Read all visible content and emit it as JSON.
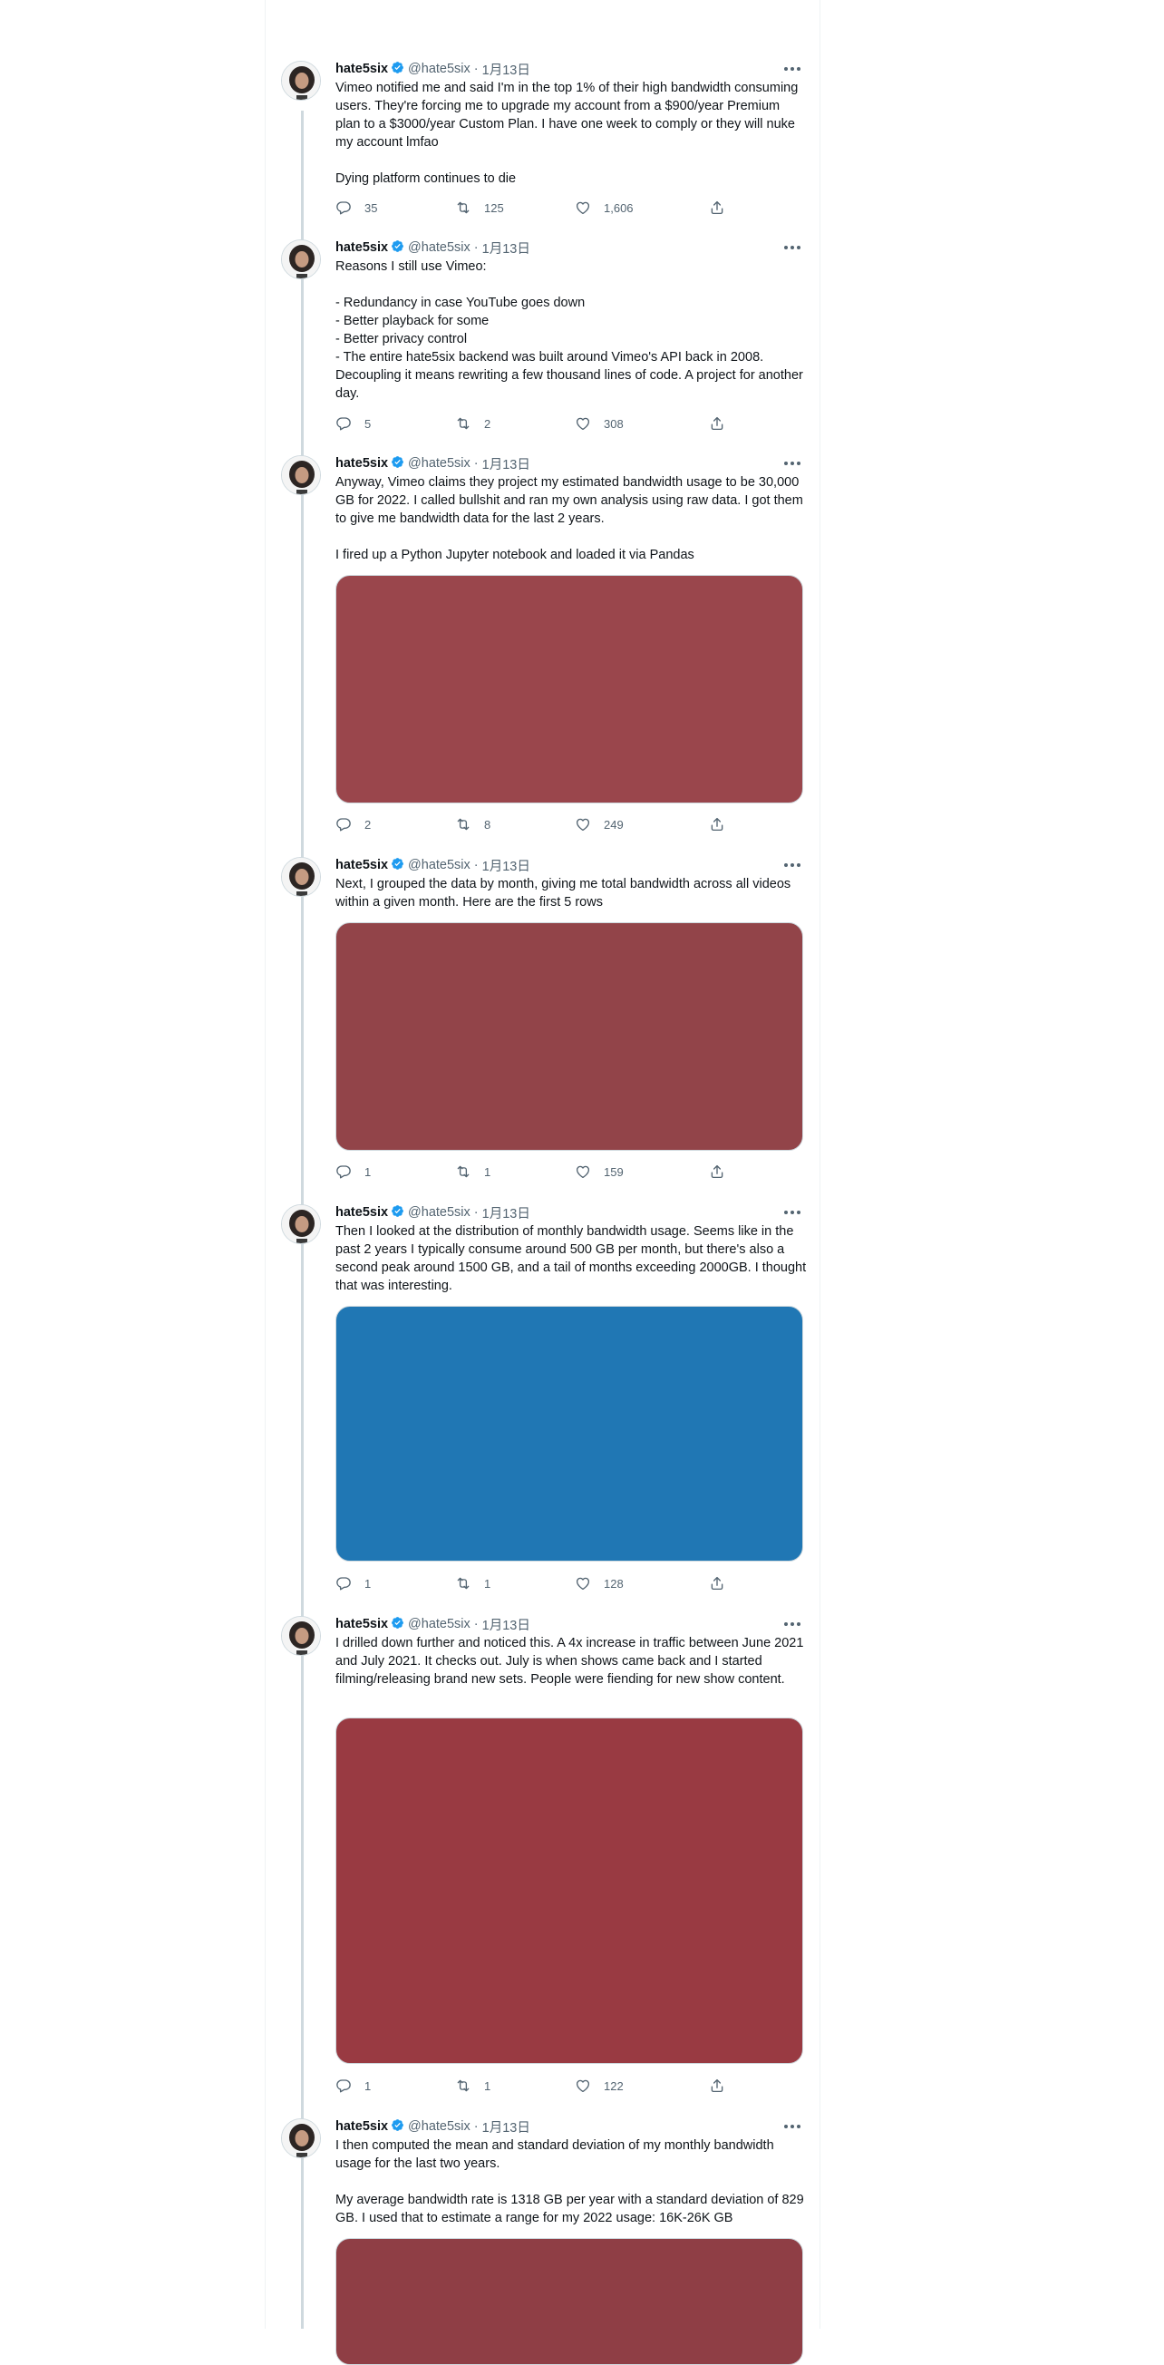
{
  "author": {
    "name": "hate5six",
    "handle": "@hate5six",
    "separator": "·"
  },
  "colors": {
    "verified": "#1d9bf0",
    "thread_line": "#cfd9de",
    "muted": "#536471"
  },
  "tweets": [
    {
      "date": "1月13日",
      "text": "Vimeo notified me and said I'm in the top 1% of their high bandwidth consuming users. They're forcing me to upgrade my account from a $900/year Premium plan to a $3000/year Custom Plan. I have one week to comply or they will nuke my account lmfao\n\nDying platform continues to die",
      "replies": "35",
      "retweets": "125",
      "likes": "1,606"
    },
    {
      "date": "1月13日",
      "text": "Reasons I still use Vimeo:\n\n- Redundancy in case YouTube goes down\n- Better playback for some\n- Better privacy control\n- The entire hate5six backend was built around Vimeo's API back in 2008. Decoupling it means rewriting a few thousand lines of code. A project for another day.",
      "replies": "5",
      "retweets": "2",
      "likes": "308"
    },
    {
      "date": "1月13日",
      "text": "Anyway, Vimeo claims they project my estimated bandwidth usage to be 30,000 GB for 2022. I called bullshit and ran my own analysis using raw data. I got them to give me bandwidth data for the last 2 years.\n\nI fired up a Python Jupyter notebook and loaded it via Pandas",
      "media_color": "#9a464c",
      "replies": "2",
      "retweets": "8",
      "likes": "249"
    },
    {
      "date": "1月13日",
      "text": "Next, I grouped the data by month, giving me total bandwidth across all videos within a given month. Here are the first 5 rows",
      "media_color": "#924449",
      "replies": "1",
      "retweets": "1",
      "likes": "159"
    },
    {
      "date": "1月13日",
      "text": "Then I looked at the distribution of monthly bandwidth usage. Seems like in the past 2 years I typically consume around 500 GB per month, but there's also a second peak around 1500 GB, and a tail of months exceeding 2000GB. I thought that was interesting.",
      "media_color": "#2077b4",
      "replies": "1",
      "retweets": "1",
      "likes": "128"
    },
    {
      "date": "1月13日",
      "text": "I drilled down further and noticed this. A 4x increase in traffic between June 2021 and July 2021. It checks out. July is when shows came back and I started filming/releasing brand new sets. People were fiending for new show content.",
      "media_color": "#993a42",
      "replies": "1",
      "retweets": "1",
      "likes": "122"
    },
    {
      "date": "1月13日",
      "text": "I then computed the mean and standard deviation of my monthly bandwidth usage for the last two years.\n\nMy average bandwidth rate is 1318 GB per year with a standard deviation of 829 GB. I used that to estimate a range for my 2022 usage: 16K-26K GB",
      "media_color": "#8f3e45"
    }
  ]
}
